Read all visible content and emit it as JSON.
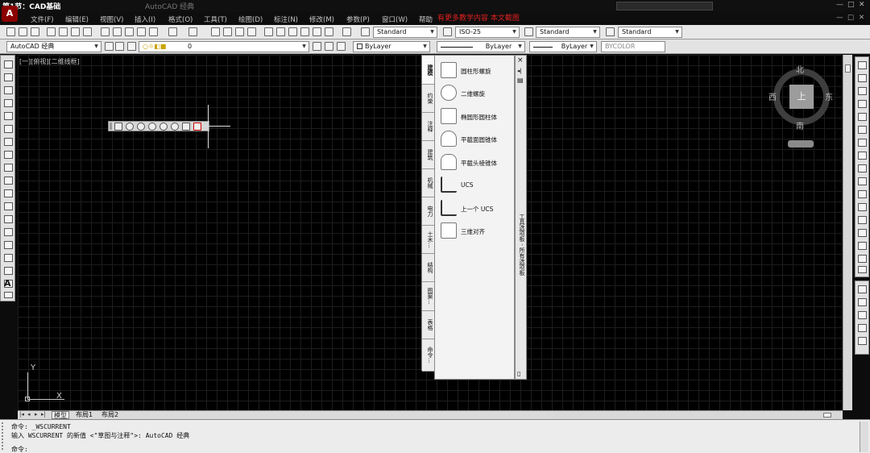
{
  "window": {
    "title": "第1节：CAD基础",
    "doc_title": "AutoCAD 经典",
    "controls": [
      "—",
      "□",
      "✕"
    ]
  },
  "menu": {
    "items": [
      "文件(F)",
      "编辑(E)",
      "视图(V)",
      "插入(I)",
      "格式(O)",
      "工具(T)",
      "绘图(D)",
      "标注(N)",
      "修改(M)",
      "参数(P)",
      "窗口(W)",
      "帮助"
    ],
    "overlay_text": "有更多教学内容 本文截图",
    "right_controls": [
      "—",
      "□",
      "✕"
    ]
  },
  "styles_toolbar": {
    "text_style": "Standard",
    "dim_style": "ISO-25",
    "table_style": "Standard",
    "mleader_style": "Standard"
  },
  "workspace": {
    "name": "AutoCAD 经典"
  },
  "layers": {
    "current": "0"
  },
  "properties": {
    "color": "ByLayer",
    "linetype": "ByLayer",
    "lineweight": "ByLayer",
    "plotstyle": "BYCOLOR"
  },
  "viewport": {
    "label": "[一][俯视][二维线框]",
    "ucs_y": "Y",
    "ucs_x": "X"
  },
  "viewcube": {
    "north": "北",
    "south": "南",
    "east": "东",
    "west": "西",
    "top": "上"
  },
  "palette": {
    "tabs": [
      "建模",
      "约束",
      "注释",
      "建筑",
      "机械",
      "电力",
      "土木...",
      "结构",
      "图案...",
      "表格",
      "命令..."
    ],
    "items": [
      "圆柱形螺旋",
      "二维螺旋",
      "椭圆形圆柱体",
      "平截面圆锥体",
      "平截头棱锥体",
      "UCS",
      "上一个 UCS",
      "三维对齐"
    ],
    "strip_controls": [
      "×",
      "◂|",
      "▤"
    ],
    "vertical_title": "工具选项板 - 所有选项板"
  },
  "layout_tabs": {
    "nav": [
      "|◂",
      "◂",
      "▸",
      "▸|"
    ],
    "tabs": [
      "模型",
      "布局1",
      "布局2"
    ]
  },
  "command": {
    "line1": "命令: _WSCURRENT",
    "line2": "输入 WSCURRENT 的新值 <\"草图与注释\">: AutoCAD 经典",
    "prompt": "命令:",
    "input_value": ""
  }
}
